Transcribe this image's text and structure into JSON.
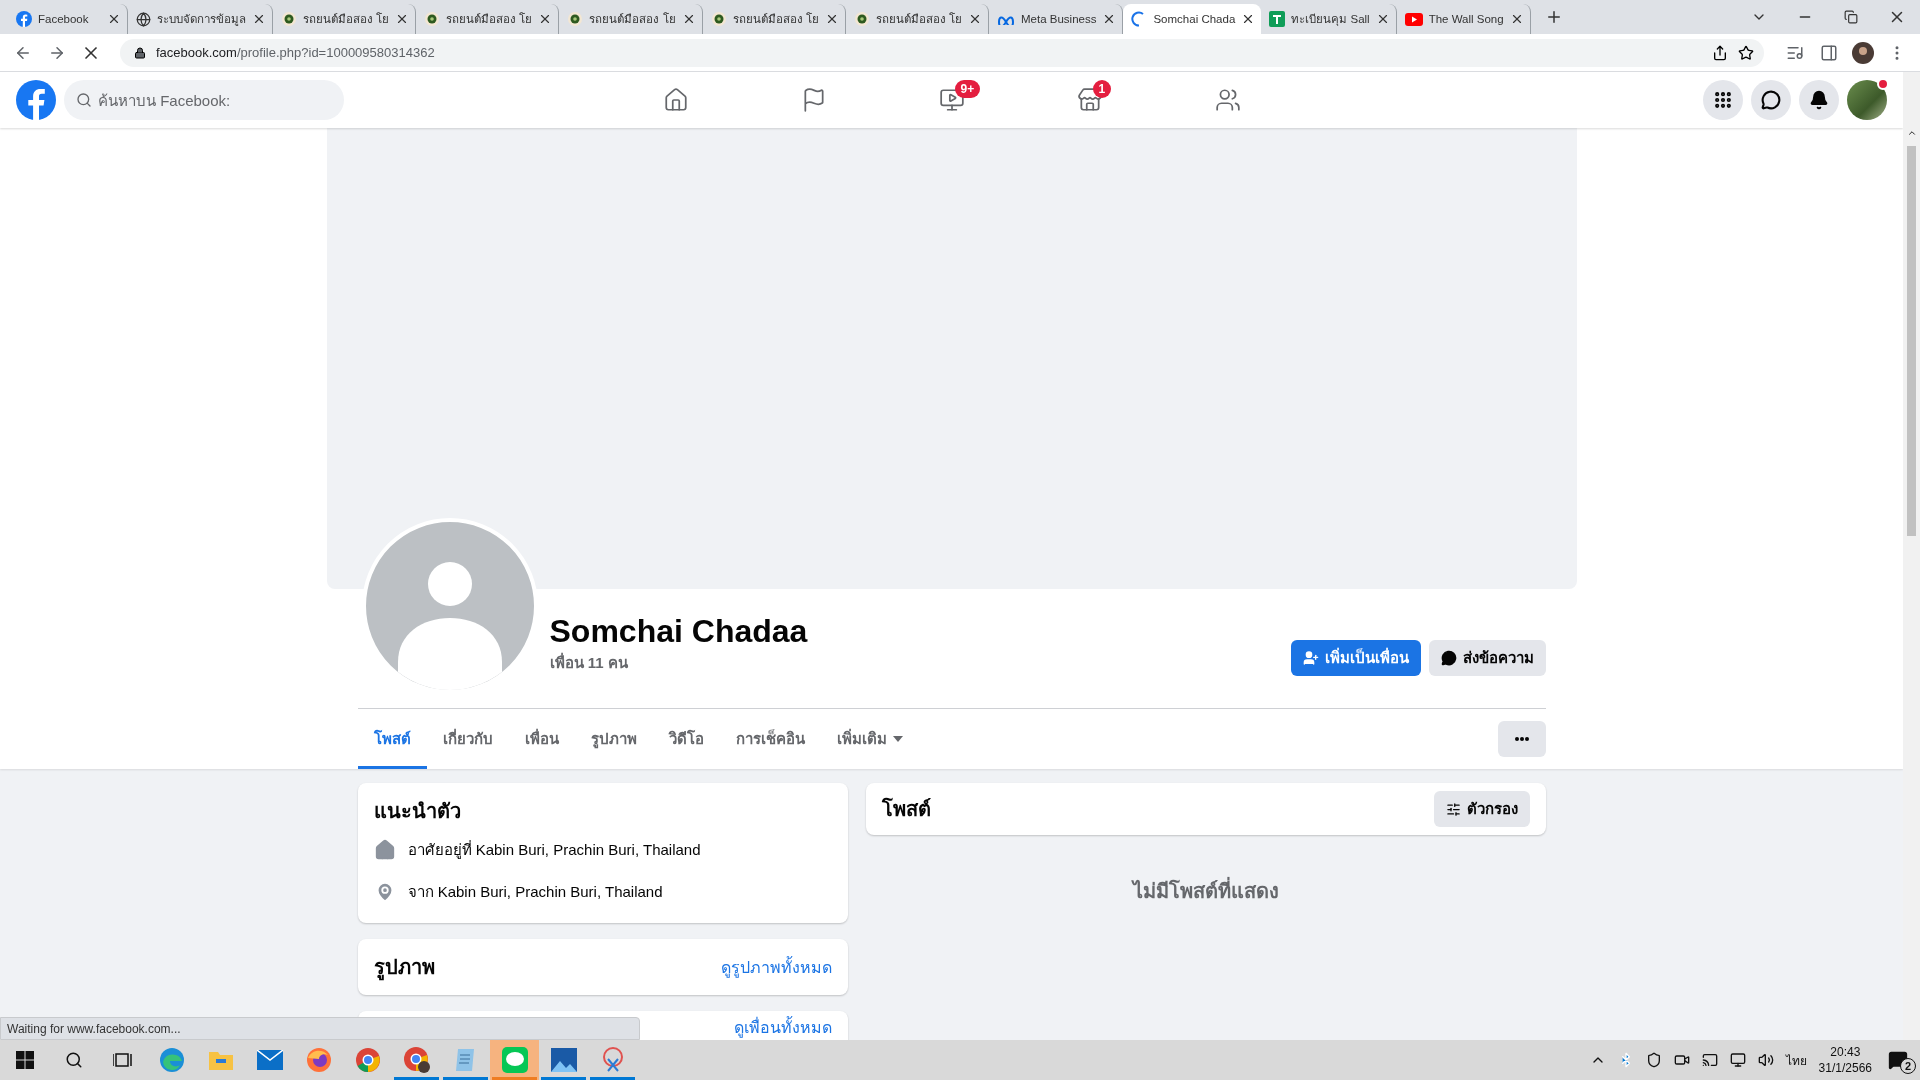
{
  "browser": {
    "tabs": [
      {
        "kind": "facebook",
        "title": "Facebook",
        "selected": false
      },
      {
        "kind": "globe",
        "title": "ระบบจัดการข้อมูล",
        "selected": false
      },
      {
        "kind": "site",
        "title": "รถยนต์มือสอง โย",
        "selected": false
      },
      {
        "kind": "site",
        "title": "รถยนต์มือสอง โย",
        "selected": false
      },
      {
        "kind": "site",
        "title": "รถยนต์มือสอง โย",
        "selected": false
      },
      {
        "kind": "site",
        "title": "รถยนต์มือสอง โย",
        "selected": false
      },
      {
        "kind": "site",
        "title": "รถยนต์มือสอง โย",
        "selected": false
      },
      {
        "kind": "meta",
        "title": "Meta Business",
        "selected": false
      },
      {
        "kind": "loading",
        "title": "Somchai Chada",
        "selected": true
      },
      {
        "kind": "sheets",
        "title": "ทะเบียนคุม Sall",
        "selected": false
      },
      {
        "kind": "youtube",
        "title": "The Wall Song",
        "selected": false
      }
    ],
    "url_host": "facebook.com",
    "url_path": "/profile.php?id=100009580314362",
    "status": "Waiting for www.facebook.com..."
  },
  "header": {
    "search": {
      "placeholder": "ค้นหาบน Facebook:"
    },
    "nav": [
      {
        "kind": "home"
      },
      {
        "kind": "flag"
      },
      {
        "kind": "video",
        "badge": "9+"
      },
      {
        "kind": "store",
        "badge": "1"
      },
      {
        "kind": "groups"
      }
    ],
    "actions": [
      {
        "kind": "menu"
      },
      {
        "kind": "messenger"
      },
      {
        "kind": "bell"
      }
    ],
    "avatar_dot": true
  },
  "profile": {
    "name": "Somchai Chadaa",
    "friends": "เพื่อน 11 คน",
    "buttons": [
      {
        "label": "เพิ่มเป็นเพื่อน",
        "kind": "primary"
      },
      {
        "label": "ส่งข้อความ",
        "kind": "secondary"
      }
    ],
    "tabs": [
      {
        "label": "โพสต์",
        "selected": true,
        "dropdown": false
      },
      {
        "label": "เกี่ยวกับ",
        "selected": false,
        "dropdown": false
      },
      {
        "label": "เพื่อน",
        "selected": false,
        "dropdown": false
      },
      {
        "label": "รูปภาพ",
        "selected": false,
        "dropdown": false
      },
      {
        "label": "วิดีโอ",
        "selected": false,
        "dropdown": false
      },
      {
        "label": "การเช็คอิน",
        "selected": false,
        "dropdown": false
      },
      {
        "label": "เพิ่มเติม",
        "selected": false,
        "dropdown": true
      }
    ]
  },
  "intro": {
    "title": "แนะนำตัว",
    "items": [
      {
        "kind": "home",
        "text": "อาศัยอยู่ที่ Kabin Buri, Prachin Buri, Thailand"
      },
      {
        "kind": "pin",
        "text": "จาก Kabin Buri, Prachin Buri, Thailand"
      }
    ]
  },
  "photos": {
    "title": "รูปภาพ",
    "link": "ดูรูปภาพทั้งหมด"
  },
  "friends_card": {
    "link": "ดูเพื่อนทั้งหมด"
  },
  "posts": {
    "title": "โพสต์",
    "filter": "ตัวกรอง",
    "empty": "ไม่มีโพสต์ที่แสดง"
  },
  "taskbar": {
    "apps": [
      {
        "kind": "edge",
        "running": false,
        "flashing": false
      },
      {
        "kind": "explorer",
        "running": false,
        "flashing": false
      },
      {
        "kind": "mail",
        "running": false,
        "flashing": false
      },
      {
        "kind": "firefox",
        "running": false,
        "flashing": false
      },
      {
        "kind": "chrome",
        "running": false,
        "flashing": false
      },
      {
        "kind": "chrome-profile",
        "running": true,
        "flashing": false
      },
      {
        "kind": "notepad",
        "running": true,
        "flashing": false
      },
      {
        "kind": "line",
        "running": true,
        "flashing": true
      },
      {
        "kind": "photos",
        "running": true,
        "flashing": false
      },
      {
        "kind": "snip",
        "running": true,
        "flashing": false
      }
    ],
    "language": "ไทย",
    "time": "20:43",
    "date": "31/1/2566",
    "notifications": "2"
  }
}
